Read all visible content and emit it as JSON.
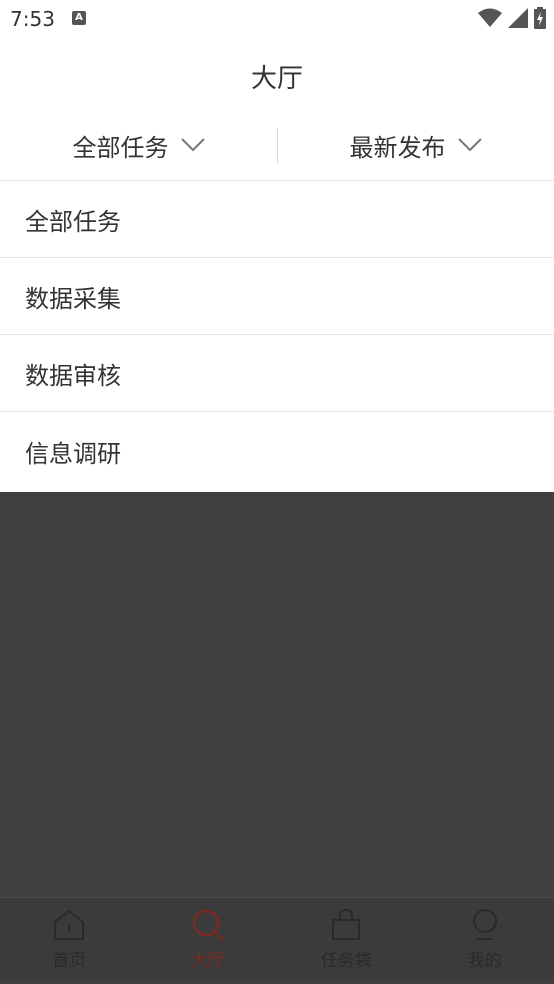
{
  "status_bar": {
    "time": "7:53",
    "notification_icon": "A"
  },
  "header": {
    "title": "大厅"
  },
  "filters": {
    "left": {
      "label": "全部任务"
    },
    "right": {
      "label": "最新发布"
    }
  },
  "dropdown": {
    "items": [
      {
        "label": "全部任务"
      },
      {
        "label": "数据采集"
      },
      {
        "label": "数据审核"
      },
      {
        "label": "信息调研"
      }
    ]
  },
  "bottom_nav": {
    "items": [
      {
        "label": "首页",
        "icon": "home-icon"
      },
      {
        "label": "大厅",
        "icon": "search-icon",
        "active": true
      },
      {
        "label": "任务袋",
        "icon": "bag-icon"
      },
      {
        "label": "我的",
        "icon": "person-icon"
      }
    ],
    "active_color": "#7a2a22"
  },
  "colors": {
    "overlay": "#404040",
    "divider": "#e2e2e2"
  }
}
